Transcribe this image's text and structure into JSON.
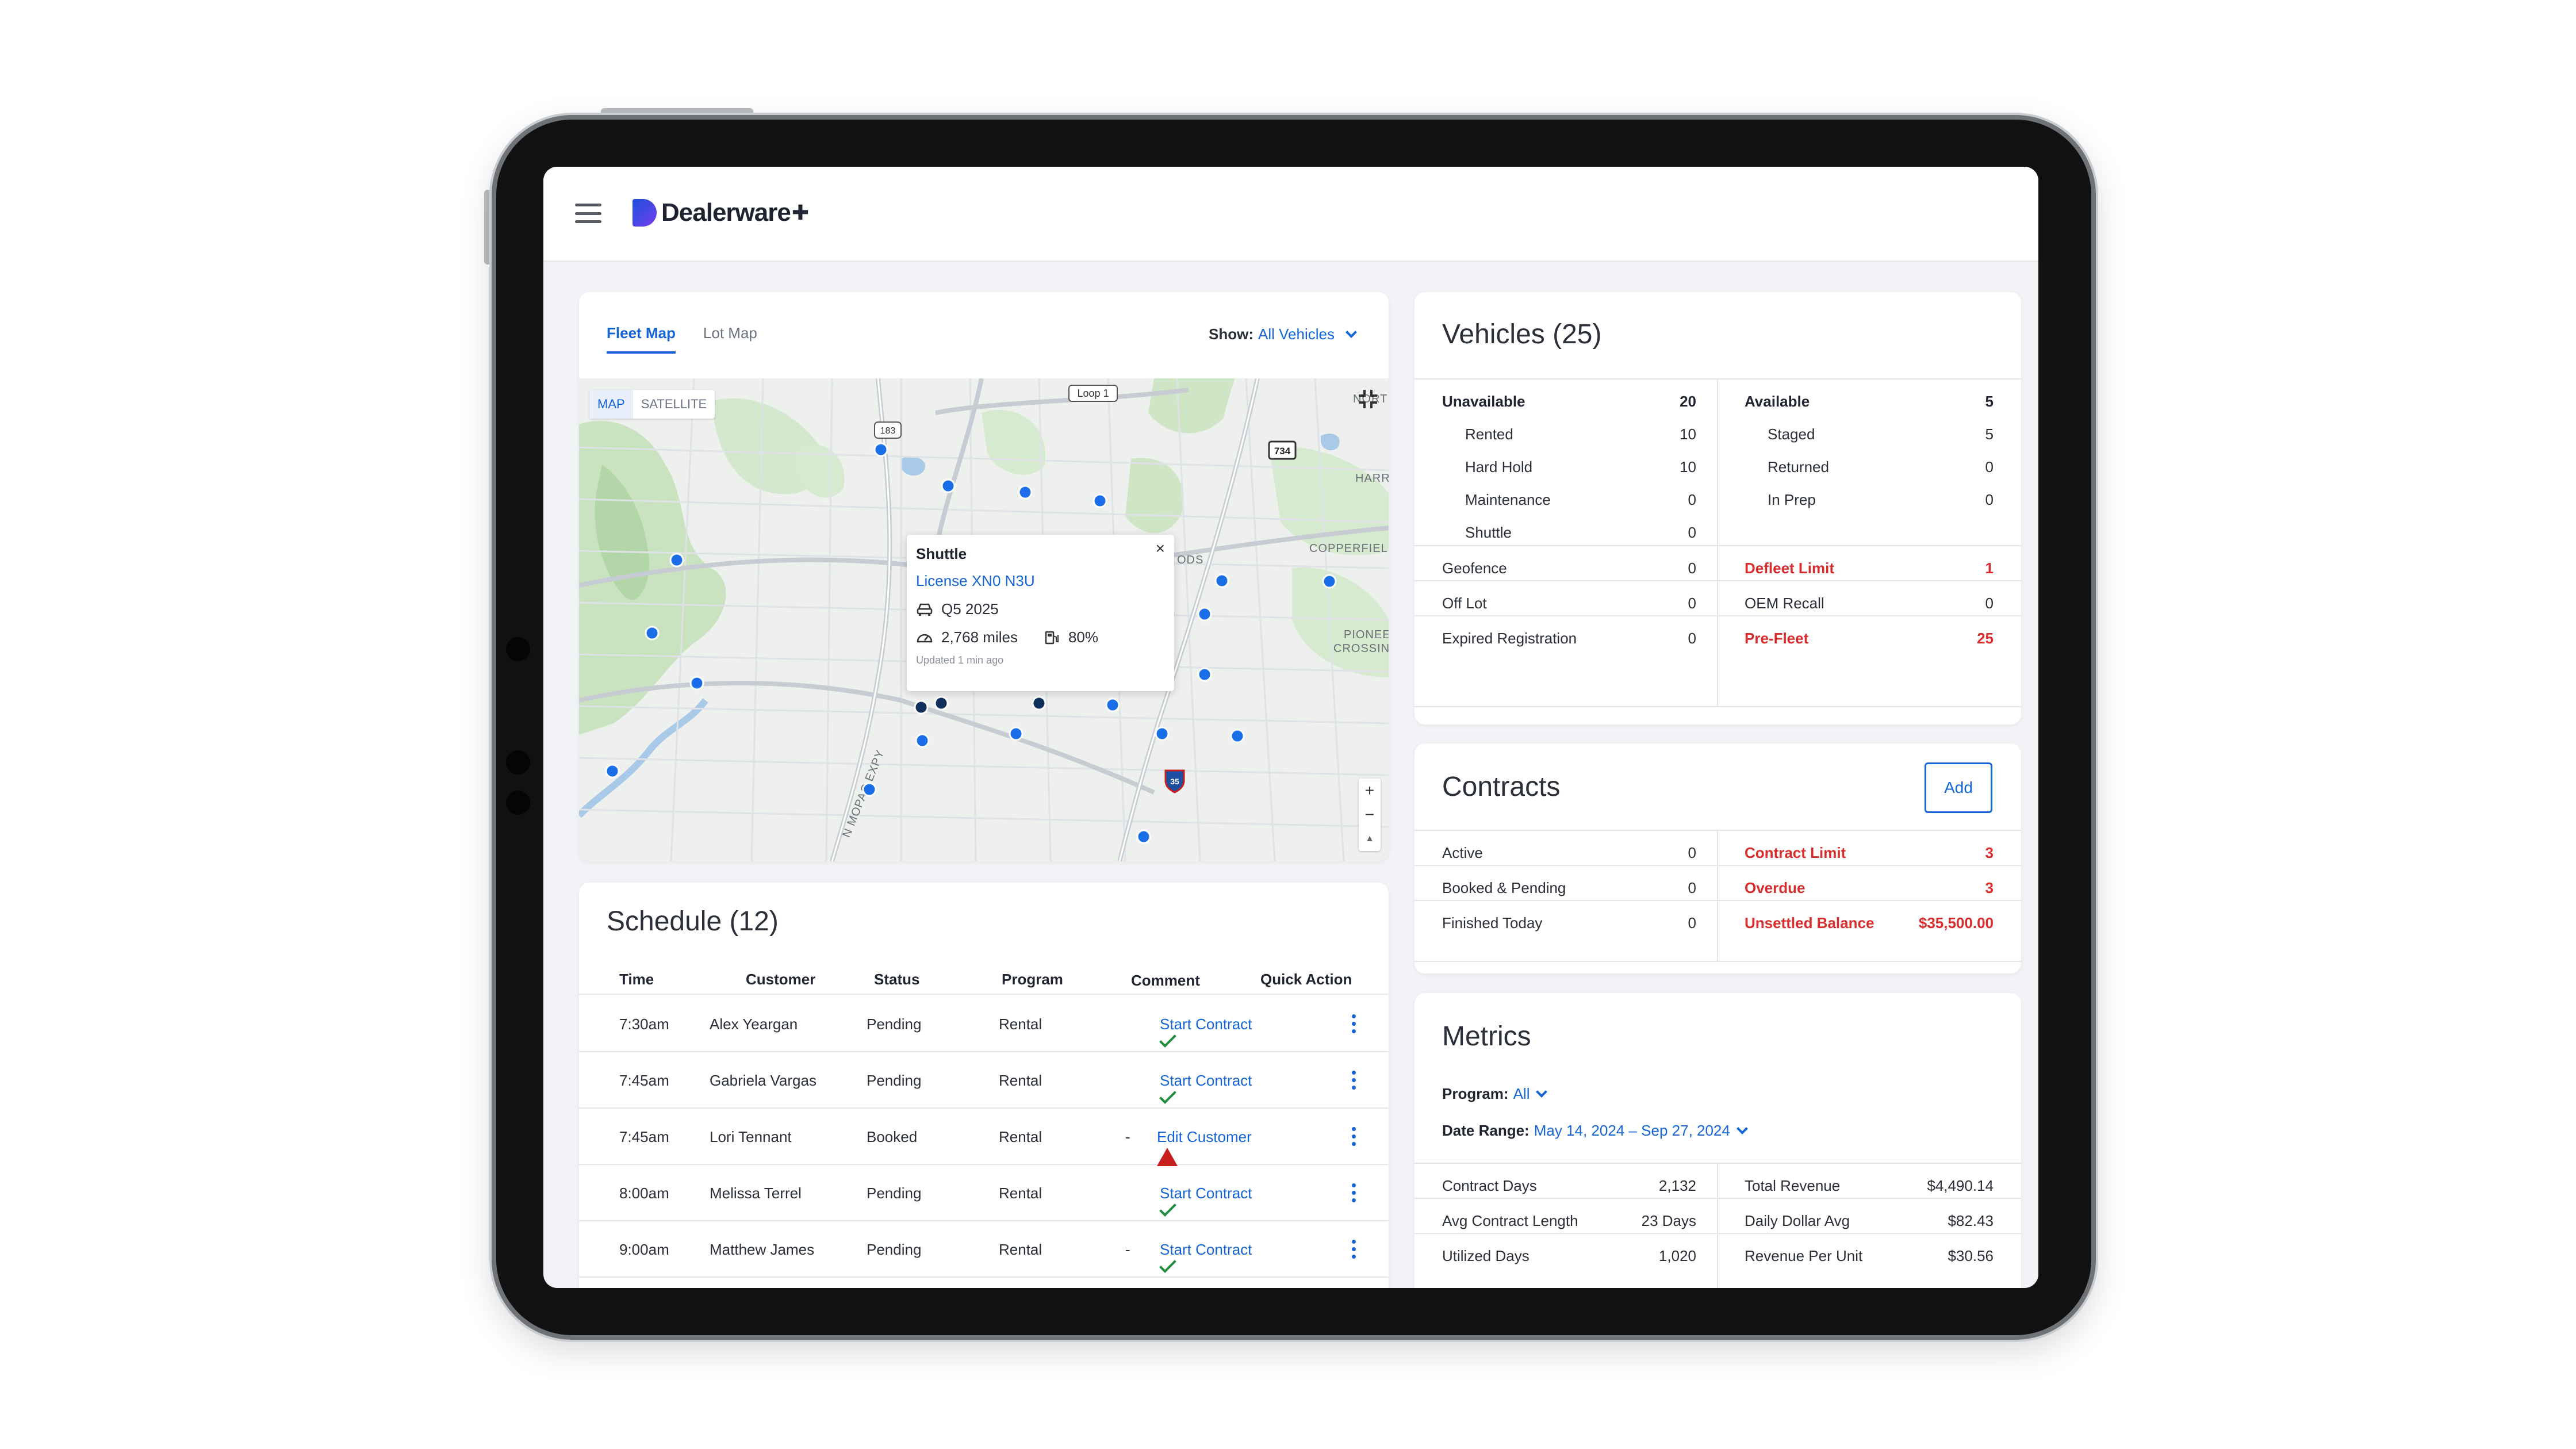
{
  "app": {
    "brand": "Dealerware"
  },
  "map": {
    "tabs": [
      "Fleet Map",
      "Lot Map"
    ],
    "show_label": "Show:",
    "show_value": "All Vehicles",
    "map_types": [
      "MAP",
      "SATELLITE"
    ],
    "labels": {
      "loop": "Loop 1",
      "hwy183": "183",
      "hwy734": "734",
      "i35": "35",
      "copperfield": "COPPERFIELD",
      "harris": "HARRI",
      "pioneer": "PIONEE",
      "crossing": "CROSSING",
      "woods": "ODS",
      "mopac": "N MOPAC EXPY",
      "north": "NORT"
    },
    "popup": {
      "title": "Shuttle",
      "license": "License XN0 N3U",
      "model": "Q5 2025",
      "mileage": "2,768 miles",
      "fuel": "80%",
      "updated": "Updated 1 min ago",
      "close": "×"
    },
    "zoom_in": "+",
    "zoom_out": "−",
    "compass": "▲"
  },
  "schedule": {
    "title": "Schedule (12)",
    "columns": [
      "Time",
      "Customer",
      "Status",
      "Program",
      "Comment",
      "Quick Action"
    ],
    "rows": [
      {
        "time": "7:30am",
        "customer": "Alex Yeargan",
        "status": "Pending",
        "program": "Rental",
        "comment": "",
        "action": "Start Contract",
        "action_type": "check"
      },
      {
        "time": "7:45am",
        "customer": "Gabriela Vargas",
        "status": "Pending",
        "program": "Rental",
        "comment": "",
        "action": "Start Contract",
        "action_type": "check"
      },
      {
        "time": "7:45am",
        "customer": "Lori Tennant",
        "status": "Booked",
        "program": "Rental",
        "comment": "-",
        "action": "Edit Customer",
        "action_type": "warning"
      },
      {
        "time": "8:00am",
        "customer": "Melissa Terrel",
        "status": "Pending",
        "program": "Rental",
        "comment": "",
        "action": "Start Contract",
        "action_type": "check"
      },
      {
        "time": "9:00am",
        "customer": "Matthew James",
        "status": "Pending",
        "program": "Rental",
        "comment": "-",
        "action": "Start Contract",
        "action_type": "check"
      }
    ]
  },
  "vehicles": {
    "title": "Vehicles (25)",
    "unavailable": {
      "label": "Unavailable",
      "value": "20"
    },
    "available": {
      "label": "Available",
      "value": "5"
    },
    "left_sub": [
      {
        "label": "Rented",
        "value": "10"
      },
      {
        "label": "Hard Hold",
        "value": "10"
      },
      {
        "label": "Maintenance",
        "value": "0"
      },
      {
        "label": "Shuttle",
        "value": "0"
      }
    ],
    "right_sub": [
      {
        "label": "Staged",
        "value": "5"
      },
      {
        "label": "Returned",
        "value": "0"
      },
      {
        "label": "In Prep",
        "value": "0"
      }
    ],
    "left_rows": [
      {
        "label": "Geofence",
        "value": "0"
      },
      {
        "label": "Off Lot",
        "value": "0"
      },
      {
        "label": "Expired Registration",
        "value": "0"
      }
    ],
    "right_rows": [
      {
        "label": "Defleet Limit",
        "value": "1"
      },
      {
        "label": "OEM Recall",
        "value": "0"
      },
      {
        "label": "Pre-Fleet",
        "value": "25"
      }
    ]
  },
  "contracts": {
    "title": "Contracts",
    "add_label": "Add",
    "left_rows": [
      {
        "label": "Active",
        "value": "0"
      },
      {
        "label": "Booked & Pending",
        "value": "0"
      },
      {
        "label": "Finished Today",
        "value": "0"
      }
    ],
    "right_rows": [
      {
        "label": "Contract Limit",
        "value": "3"
      },
      {
        "label": "Overdue",
        "value": "3"
      },
      {
        "label": "Unsettled Balance",
        "value": "$35,500.00"
      }
    ]
  },
  "metrics": {
    "title": "Metrics",
    "program_label": "Program:",
    "program_value": "All",
    "date_label": "Date Range:",
    "date_value": "May 14, 2024 – Sep 27, 2024",
    "left_rows": [
      {
        "label": "Contract Days",
        "value": "2,132"
      },
      {
        "label": "Avg Contract Length",
        "value": "23 Days"
      },
      {
        "label": "Utilized Days",
        "value": "1,020"
      }
    ],
    "right_rows": [
      {
        "label": "Total Revenue",
        "value": "$4,490.14"
      },
      {
        "label": "Daily Dollar Avg",
        "value": "$82.43"
      },
      {
        "label": "Revenue Per Unit",
        "value": "$30.56"
      }
    ]
  },
  "colors": {
    "accent": "#1565d8",
    "alert": "#d92d2d",
    "success": "#1e8e3e",
    "vehicle_dot": "#1a6ee8",
    "vehicle_dot_dark": "#0f2f5c"
  }
}
